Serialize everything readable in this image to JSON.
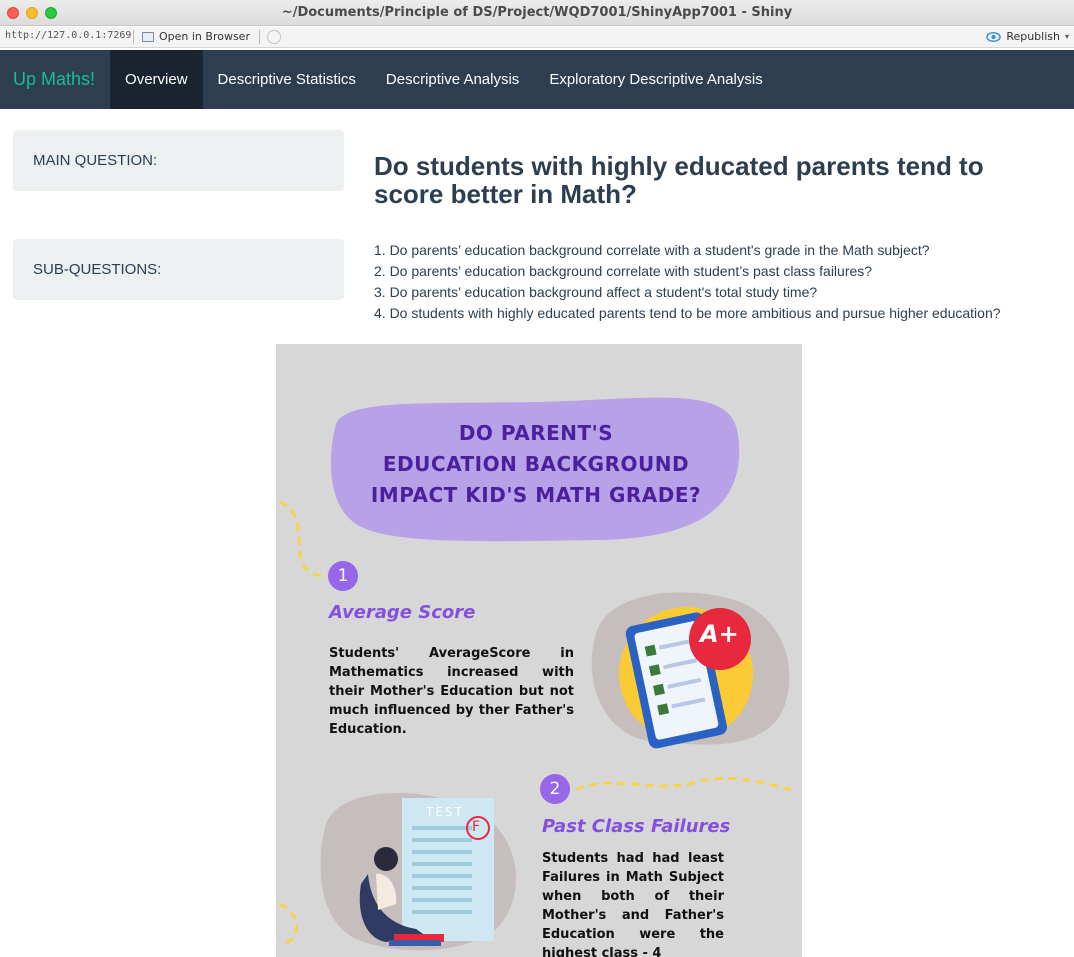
{
  "window": {
    "title": "~/Documents/Principle of DS/Project/WQD7001/ShinyApp7001 - Shiny"
  },
  "viewer_toolbar": {
    "url": "http://127.0.0.1:7269",
    "open_in_browser": "Open in Browser",
    "republish": "Republish"
  },
  "navbar": {
    "brand": "Up Maths!",
    "tabs": [
      {
        "label": "Overview",
        "active": true
      },
      {
        "label": "Descriptive Statistics"
      },
      {
        "label": "Descriptive Analysis"
      },
      {
        "label": "Exploratory Descriptive Analysis"
      }
    ]
  },
  "sidebar": {
    "main_label": "MAIN QUESTION:",
    "sub_label": "SUB-QUESTIONS:"
  },
  "main": {
    "question": "Do students with highly educated parents tend to score better in Math?",
    "sub_questions": [
      "1. Do parents’ education background correlate with a student's grade in the Math subject?",
      "2. Do parents’ education background correlate with student’s past class failures?",
      "3. Do parents’ education background affect a student's total study time?",
      "4. Do students with highly educated parents tend to be more ambitious and pursue higher education?"
    ]
  },
  "infographic": {
    "title_lines": [
      "DO PARENT'S",
      "EDUCATION BACKGROUND",
      "IMPACT KID'S MATH GRADE?"
    ],
    "section1": {
      "number": "1",
      "heading": "Average Score",
      "body": "Students' AverageScore in Mathematics increased with their Mother's Education but not much influenced by ther Father's Education.",
      "grade": "A+"
    },
    "section2": {
      "number": "2",
      "heading": "Past Class Failures",
      "body": "Students had had least Failures in Math Subject when both of their Mother's and Father's Education were the highest class - 4",
      "test_label": "TEST",
      "test_grade": "F"
    }
  }
}
